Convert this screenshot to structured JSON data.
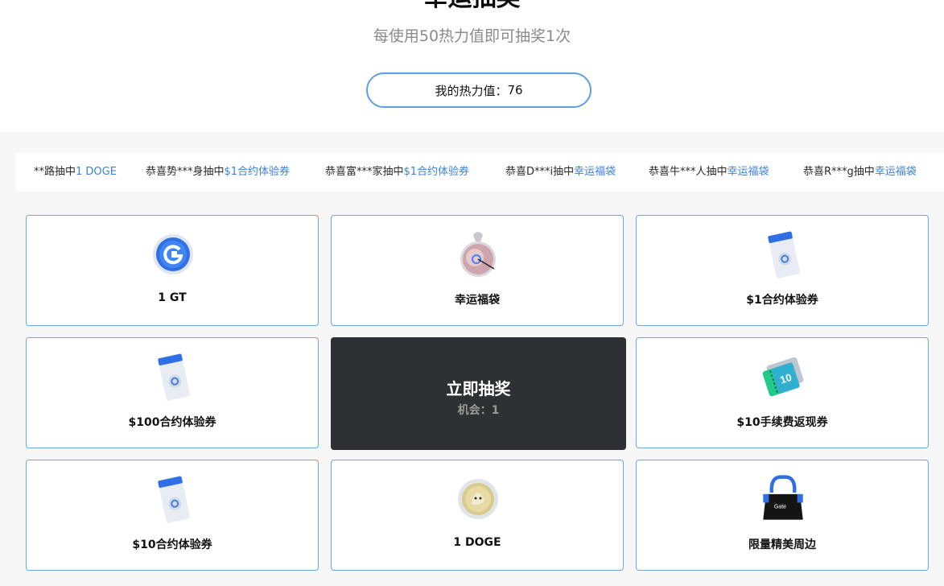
{
  "header": {
    "title": "幸运抽奖",
    "subtitle": "每使用50热力值即可抽奖1次",
    "heat_label": "我的热力值：",
    "heat_value": "76"
  },
  "ticker": [
    {
      "prefix": "**路抽中",
      "prize": "1 DOGE"
    },
    {
      "prefix": "恭喜势***身抽中",
      "prize": "$1合约体验券"
    },
    {
      "prefix": "恭喜富***家抽中",
      "prize": "$1合约体验券"
    },
    {
      "prefix": "恭喜D***i抽中",
      "prize": "幸运福袋"
    },
    {
      "prefix": "恭喜牛***人抽中",
      "prize": "幸运福袋"
    },
    {
      "prefix": "恭喜R***g抽中",
      "prize": "幸运福袋"
    }
  ],
  "prizes": [
    {
      "label": "1 GT",
      "icon": "gt-coin-icon"
    },
    {
      "label": "幸运福袋",
      "icon": "lucky-bag-icon"
    },
    {
      "label": "$1合约体验券",
      "icon": "contract-voucher-icon"
    },
    {
      "label": "$100合约体验券",
      "icon": "contract-voucher-icon"
    },
    {
      "label": "$10手续费返现券",
      "icon": "fee-rebate-ticket-icon",
      "ticket_text": "10"
    },
    {
      "label": "$10合约体验券",
      "icon": "contract-voucher-icon"
    },
    {
      "label": "1 DOGE",
      "icon": "doge-coin-icon"
    },
    {
      "label": "限量精美周边",
      "icon": "tote-bag-icon",
      "bag_text": "Gate"
    }
  ],
  "draw_button": {
    "label": "立即抽奖",
    "chances_label": "机会：",
    "chances_value": "1"
  },
  "colors": {
    "accent": "#3b82d6",
    "card_border": "#6aa6e4",
    "draw_button_bg": "#2f3033"
  }
}
